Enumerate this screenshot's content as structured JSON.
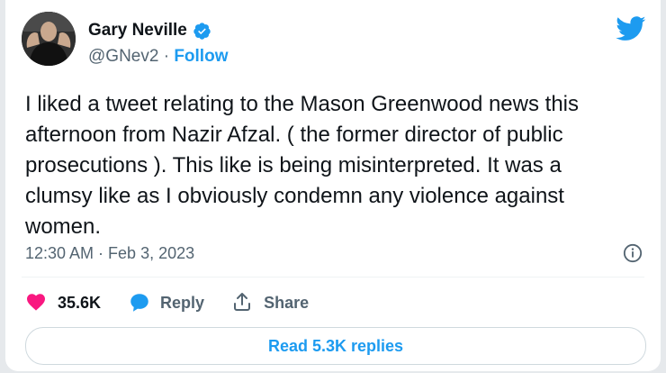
{
  "author": {
    "display_name": "Gary Neville",
    "handle": "@GNev2",
    "separator": " · ",
    "follow_label": "Follow",
    "verified": true
  },
  "tweet": {
    "text": "I liked a tweet relating to the Mason Greenwood news this\nafternoon from Nazir Afzal. ( the former director of public\nprosecutions ). This like is being misinterpreted. It was a\nclumsy like as I obviously condemn any violence against\nwomen.",
    "timestamp": "12:30 AM · Feb 3, 2023"
  },
  "actions": {
    "likes_count": "35.6K",
    "reply_label": "Reply",
    "share_label": "Share"
  },
  "footer": {
    "read_replies_label": "Read 5.3K replies"
  },
  "colors": {
    "accent": "#1d9bf0",
    "like": "#f91880",
    "text": "#0f1419",
    "muted": "#536471"
  },
  "icons": [
    "verified-badge-icon",
    "twitter-bird-icon",
    "info-icon",
    "heart-icon",
    "reply-bubble-icon",
    "share-icon"
  ]
}
